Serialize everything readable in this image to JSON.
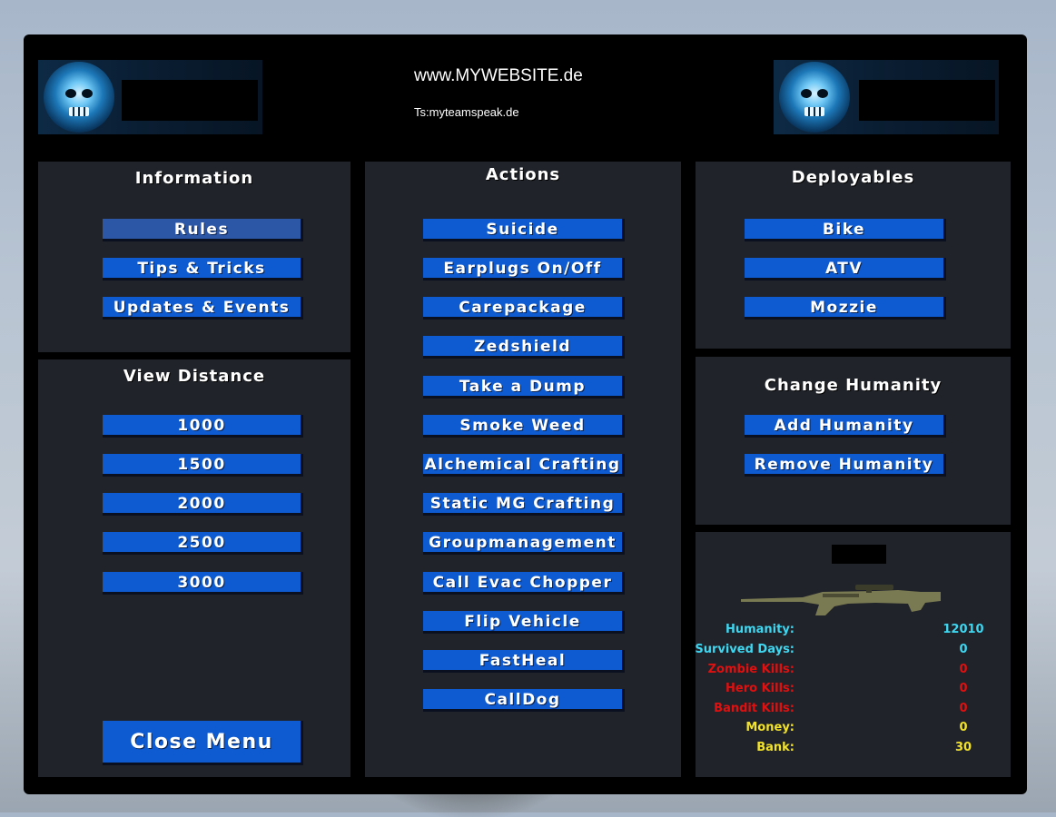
{
  "header": {
    "website": "www.MYWEBSITE.de",
    "teamspeak": "Ts:myteamspeak.de"
  },
  "information": {
    "title": "Information",
    "buttons": [
      "Rules",
      "Tips & Tricks",
      "Updates & Events"
    ]
  },
  "view_distance": {
    "title": "View Distance",
    "buttons": [
      "1000",
      "1500",
      "2000",
      "2500",
      "3000"
    ]
  },
  "close_button": "Close Menu",
  "actions": {
    "title": "Actions",
    "buttons": [
      "Suicide",
      "Earplugs On/Off",
      "Carepackage",
      "Zedshield",
      "Take a Dump",
      "Smoke Weed",
      "Alchemical Crafting",
      "Static MG Crafting",
      "Groupmanagement",
      "Call Evac Chopper",
      "Flip Vehicle",
      "FastHeal",
      "CallDog"
    ]
  },
  "deployables": {
    "title": "Deployables",
    "buttons": [
      "Bike",
      "ATV",
      "Mozzie"
    ]
  },
  "humanity": {
    "title": "Change Humanity",
    "buttons": [
      "Add Humanity",
      "Remove Humanity"
    ]
  },
  "stats": [
    {
      "label": "Humanity:",
      "value": "12010",
      "color": "#3fd6f0"
    },
    {
      "label": "Survived Days:",
      "value": "0",
      "color": "#3fd6f0"
    },
    {
      "label": "Zombie Kills:",
      "value": "0",
      "color": "#e01010"
    },
    {
      "label": "Hero Kills:",
      "value": "0",
      "color": "#e01010"
    },
    {
      "label": "Bandit Kills:",
      "value": "0",
      "color": "#e01010"
    },
    {
      "label": "Money:",
      "value": "0",
      "color": "#f2e22a"
    },
    {
      "label": "Bank:",
      "value": "30",
      "color": "#f2e22a"
    }
  ],
  "colors": {
    "button": "#0e5bd1",
    "button_hover": "#2c56a6",
    "panel": "#22262c"
  },
  "icons": [
    "skull-logo-icon",
    "rifle-icon"
  ]
}
